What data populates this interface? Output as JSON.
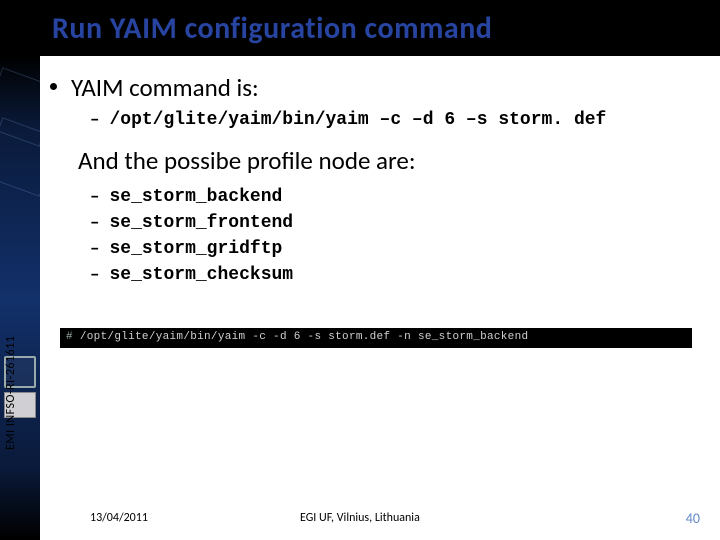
{
  "title": "Run YAIM configuration command",
  "bullet1": "YAIM command is:",
  "command_line": "/opt/glite/yaim/bin/yaim –c –d 6 –s storm. def",
  "section2": "And the possibe profile node are:",
  "profiles": {
    "p1": "se_storm_backend",
    "p2": "se_storm_frontend",
    "p3": "se_storm_gridftp",
    "p4": "se_storm_checksum"
  },
  "terminal": {
    "prompt": "# ",
    "cmd": "/opt/glite/yaim/bin/yaim -c -d 6 -s storm.def -n se_storm_backend"
  },
  "side_label": "EMI INFSO-RI-261611",
  "footer": {
    "date": "13/04/2011",
    "venue": "EGI UF, Vilnius, Lithuania",
    "page": "40"
  }
}
